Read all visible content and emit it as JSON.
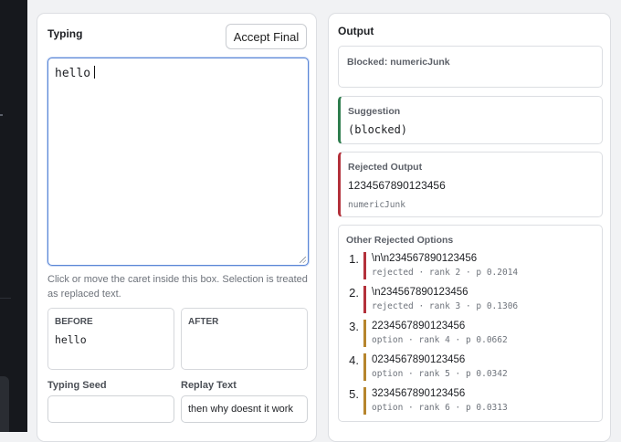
{
  "colors": {
    "accept": "#2f7d4e",
    "reject": "#b3313b",
    "option": "#b6852d",
    "focus": "#5a86d6"
  },
  "typing": {
    "title": "Typing",
    "accept_label": "Accept Final",
    "editor_value": "hello",
    "help_text": "Click or move the caret inside this box. Selection is treated as replaced text.",
    "before_label": "BEFORE",
    "before_value": "hello",
    "after_label": "AFTER",
    "after_value": "",
    "seed_label": "Typing Seed",
    "seed_value": "",
    "replay_label": "Replay Text",
    "replay_value": "then why doesnt it work"
  },
  "output": {
    "title": "Output",
    "status": "Blocked: numericJunk",
    "suggestion_label": "Suggestion",
    "suggestion_value": "(blocked)",
    "rejected_label": "Rejected Output",
    "rejected_value": "1234567890123456",
    "rejected_reason": "numericJunk",
    "others_title": "Other Rejected Options",
    "options": [
      {
        "num": "1.",
        "text": "\\n\\n234567890123456",
        "meta": "rejected · rank 2 · p 0.2014",
        "kind": "reject"
      },
      {
        "num": "2.",
        "text": "\\n234567890123456",
        "meta": "rejected · rank 3 · p 0.1306",
        "kind": "reject"
      },
      {
        "num": "3.",
        "text": "2234567890123456",
        "meta": "option · rank 4 · p 0.0662",
        "kind": "option"
      },
      {
        "num": "4.",
        "text": "0234567890123456",
        "meta": "option · rank 5 · p 0.0342",
        "kind": "option"
      },
      {
        "num": "5.",
        "text": "3234567890123456",
        "meta": "option · rank 6 · p 0.0313",
        "kind": "option"
      }
    ]
  }
}
